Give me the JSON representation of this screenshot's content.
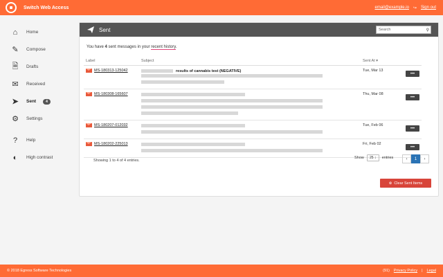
{
  "app": {
    "title": "Switch Web Access"
  },
  "top": {
    "email": "email@example.io",
    "signout": "Sign out"
  },
  "nav": [
    {
      "label": "Home",
      "icon": "home-icon"
    },
    {
      "label": "Compose",
      "icon": "compose-icon"
    },
    {
      "label": "Drafts",
      "icon": "drafts-icon"
    },
    {
      "label": "Received",
      "icon": "inbox-icon"
    },
    {
      "label": "Sent",
      "icon": "send-icon",
      "badge": "4"
    },
    {
      "label": "Settings",
      "icon": "gear-icon"
    },
    {
      "label": "Help",
      "icon": "help-icon"
    },
    {
      "label": "High contrast",
      "icon": "contrast-icon"
    }
  ],
  "panel": {
    "title": "Sent",
    "search_placeholder": "Search",
    "summary_prefix": "You have",
    "count": "4",
    "summary_mid": "sent messages in your",
    "summary_link": "recent history",
    "summary_end": "."
  },
  "table": {
    "headers": [
      "Label",
      "Subject",
      "Sent At ▾"
    ],
    "rows": [
      {
        "label": "MS-180313-125042",
        "subject_bold": "results of cannabis test (NEGATIVE)",
        "sent": "Tue, Mar 13"
      },
      {
        "label": "MS-180308-165607",
        "subject_bold": "",
        "sent": "Thu, Mar 08"
      },
      {
        "label": "MS-180207-012032",
        "subject_bold": "",
        "sent": "Tue, Feb 06"
      },
      {
        "label": "MS-180202-225013",
        "subject_bold": "",
        "sent": "Fri, Feb 02"
      }
    ],
    "more": "•••"
  },
  "footer_table": {
    "showing": "Showing 1 to 4 of 4 entries.",
    "show": "Show",
    "entries_value": "25",
    "entries": "entries",
    "page": "1"
  },
  "clear_button": "Clear Sent Items",
  "footer": {
    "copyright": "© 2018 Egress Software Technologies",
    "version": "(91)",
    "privacy": "Privacy Policy",
    "legal": "Legal"
  }
}
